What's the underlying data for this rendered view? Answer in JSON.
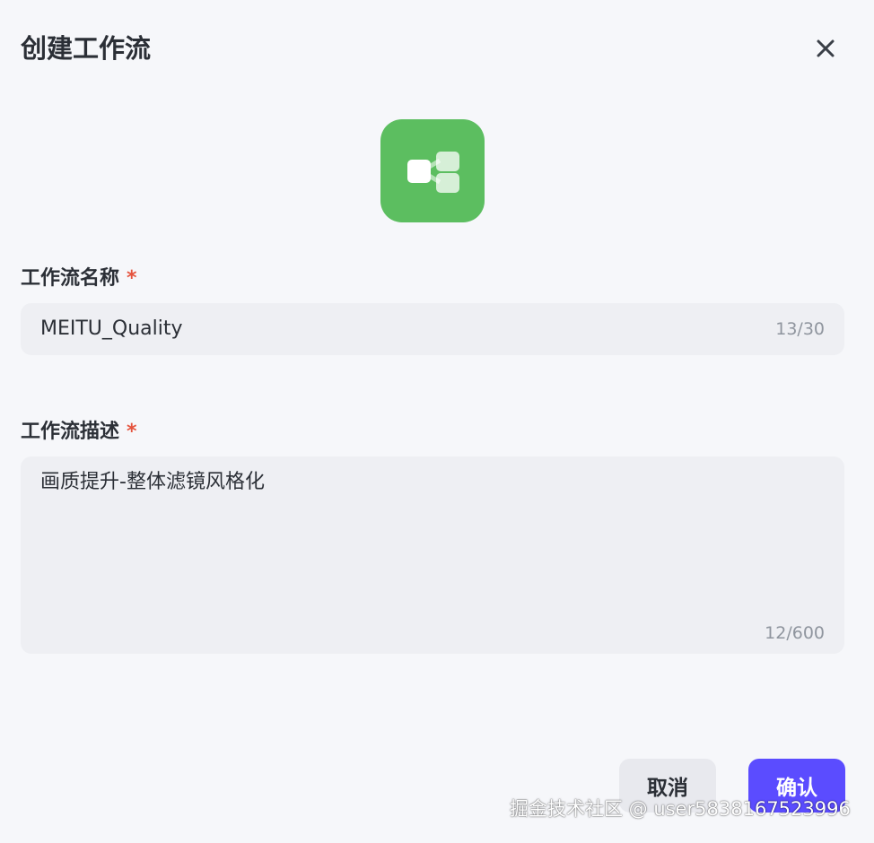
{
  "dialog": {
    "title": "创建工作流",
    "close_icon": "close-icon",
    "app_icon": "workflow-icon",
    "accent_color": "#5cbe60"
  },
  "name_field": {
    "label": "工作流名称",
    "required_mark": "*",
    "value": "MEITU_Quality",
    "counter": "13/30"
  },
  "desc_field": {
    "label": "工作流描述",
    "required_mark": "*",
    "value": "画质提升-整体滤镜风格化",
    "counter": "12/600"
  },
  "footer": {
    "cancel_label": "取消",
    "confirm_label": "确认",
    "confirm_color": "#5b4cff"
  },
  "watermark": {
    "text": "掘金技术社区 @ user5838167523996"
  }
}
